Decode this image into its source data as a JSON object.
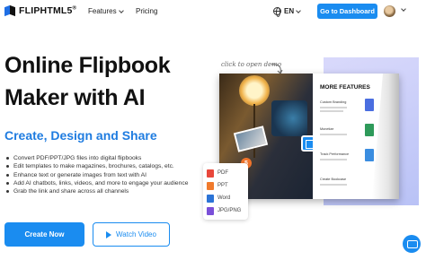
{
  "nav": {
    "logo_text": "FLIPHTML5",
    "logo_reg": "®",
    "features_label": "Features",
    "pricing_label": "Pricing",
    "language": "EN",
    "dashboard_button": "Go to Dashboard"
  },
  "hero": {
    "title_line1": "Online Flipbook",
    "title_line2": "Maker with AI",
    "subtitle": "Create, Design and Share",
    "bullets": [
      "Convert PDF/PPT/JPG files into digital flipbooks",
      "Edit templates to make magazines, brochures, catalogs, etc.",
      "Enhance text or generate images from text with AI",
      "Add AI chatbots, links, videos, and more to engage your audience",
      "Grab the link and share across all channels"
    ],
    "create_button": "Create Now",
    "watch_button": "Watch Video"
  },
  "visual": {
    "note": "click to open demo",
    "book_heading": "MORE FEATURES",
    "book_items": [
      "Custom Branding",
      "Monetize",
      "Track Performance",
      "Create Bookcase"
    ],
    "formats": [
      {
        "label": "PDF",
        "color": "#e8473b"
      },
      {
        "label": "PPT",
        "color": "#f07a2c"
      },
      {
        "label": "Word",
        "color": "#2b73d6"
      },
      {
        "label": "JPG/PNG",
        "color": "#7a4fd8"
      }
    ]
  },
  "colors": {
    "accent": "#1a8cf0",
    "subtitle": "#1f7ce0"
  }
}
